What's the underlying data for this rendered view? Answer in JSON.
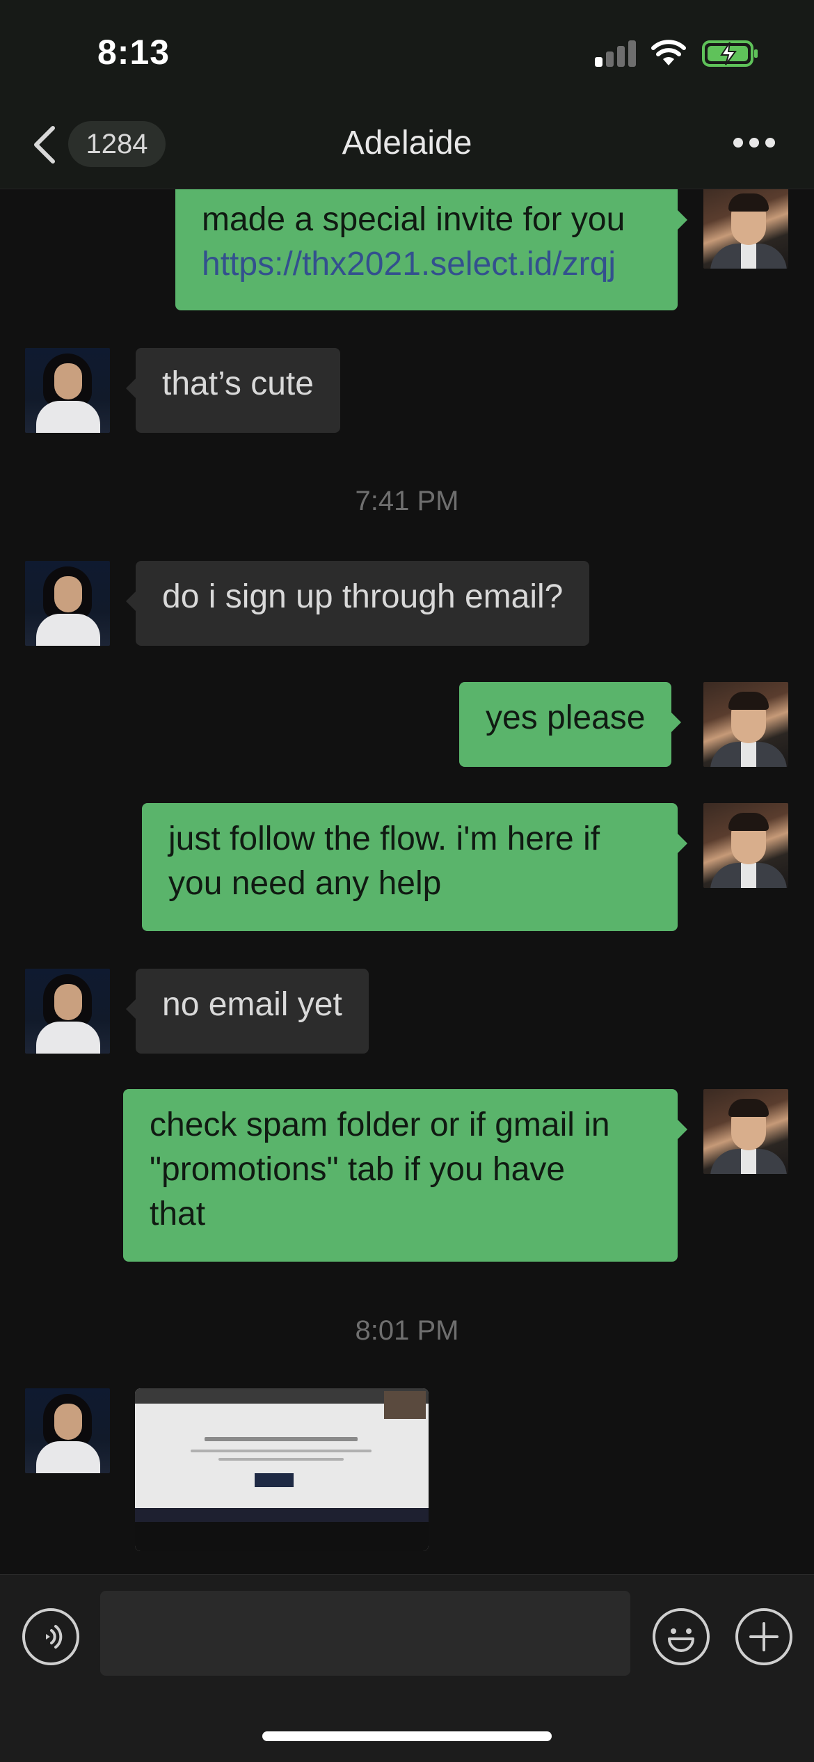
{
  "status_bar": {
    "time": "8:13"
  },
  "nav": {
    "unread_count": "1284",
    "contact_name": "Adelaide"
  },
  "messages": [
    {
      "sender": "me",
      "lines": [
        "made a special invite for you"
      ],
      "link": "https://thx2021.select.id/zrqj"
    },
    {
      "sender": "her",
      "text": "that’s cute"
    },
    {
      "timestamp": "7:41 PM"
    },
    {
      "sender": "her",
      "text": "do i sign up through email?"
    },
    {
      "sender": "me",
      "text": "yes please"
    },
    {
      "sender": "me",
      "lines": [
        "just follow the flow.  i'm here if",
        "you need any help"
      ]
    },
    {
      "sender": "her",
      "text": "no email yet"
    },
    {
      "sender": "me",
      "lines": [
        "check spam folder or if gmail in",
        "\"promotions\" tab if you have",
        "that"
      ]
    },
    {
      "timestamp": "8:01 PM"
    },
    {
      "sender": "her",
      "attachment": "photo"
    }
  ],
  "input_bar": {
    "icons": [
      "voice-icon",
      "emoji-icon",
      "plus-icon"
    ]
  },
  "colors": {
    "outgoing_bubble": "#5ab46b",
    "incoming_bubble": "#2c2c2c",
    "background": "#111111",
    "link": "#33508e"
  }
}
